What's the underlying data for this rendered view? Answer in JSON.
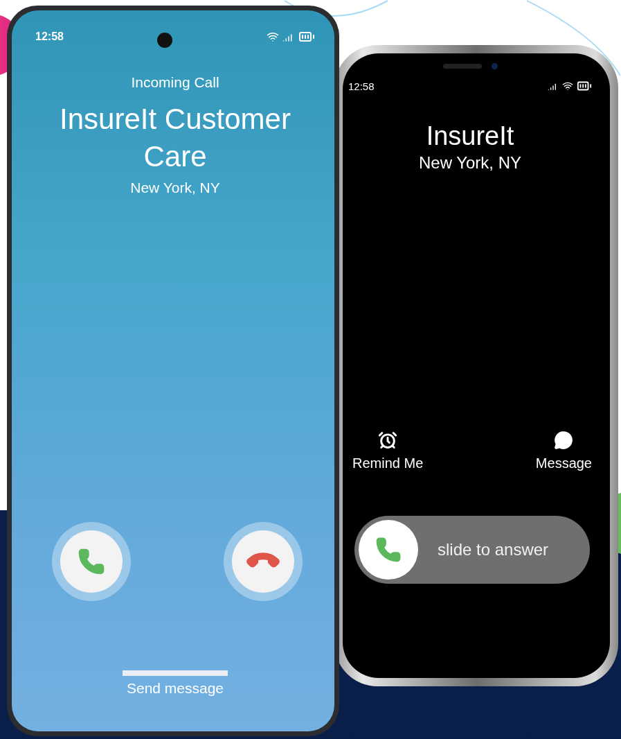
{
  "left_phone": {
    "status_time": "12:58",
    "header": "Incoming Call",
    "caller": "InsureIt Customer Care",
    "location": "New York, NY",
    "actions": [
      {
        "kind": "accept"
      },
      {
        "kind": "decline"
      }
    ],
    "send_message": "Send message"
  },
  "right_phone": {
    "status_time": "12:58",
    "caller": "InsureIt",
    "location": "New York, NY",
    "options": [
      {
        "kind": "remind",
        "label": "Remind Me"
      },
      {
        "kind": "message",
        "label": "Message"
      }
    ],
    "slider": {
      "label": "slide to answer",
      "level": 0
    }
  }
}
